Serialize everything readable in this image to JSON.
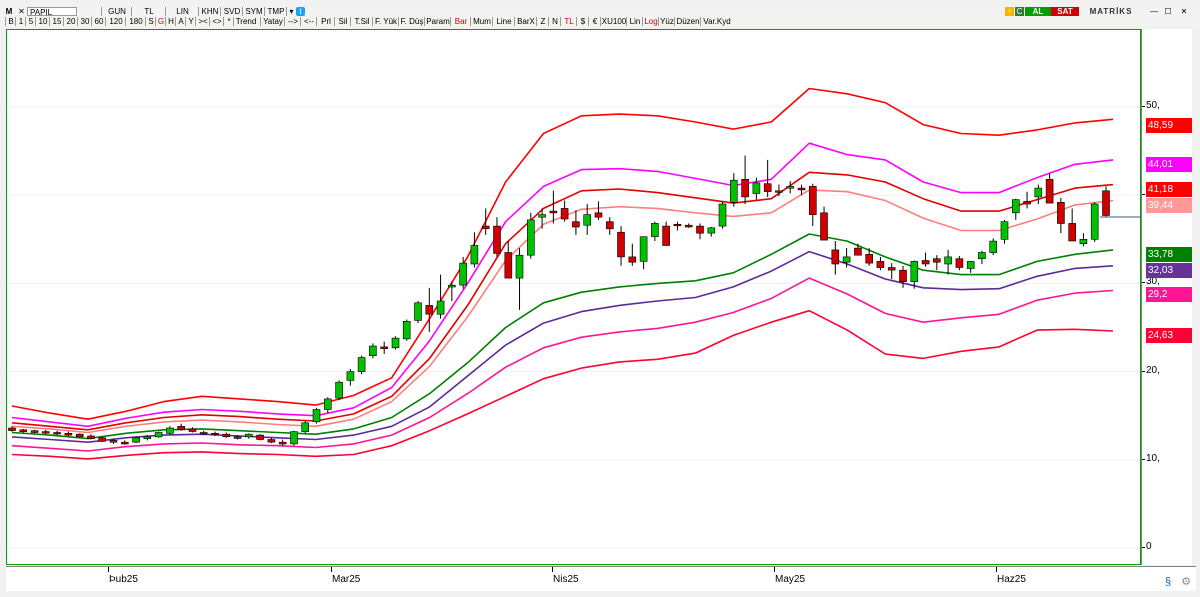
{
  "toolbar_top": {
    "window_icon": "M",
    "symbol": "PAPIL",
    "period": "GUN",
    "currency": "TL",
    "scale": "LIN",
    "items": [
      "KHN",
      "SVD",
      "SYM",
      "TMP"
    ],
    "market_status": {
      "buy": "AL",
      "sell": "SAT"
    },
    "brand": "MATRİKS"
  },
  "toolbar_bottom": {
    "items": [
      "B",
      "1",
      "5",
      "10",
      "15",
      "20",
      "30",
      "60",
      "120",
      "180",
      "S",
      "G",
      "H",
      "A",
      "Y",
      "><",
      "<>",
      "*",
      "Trend",
      "Yatay",
      "-->",
      "<--",
      "Prl",
      "Sil",
      "T.Sil",
      "F. Yük",
      "F. Düş",
      "Param",
      "Bar",
      "Mum",
      "Line",
      "BarX",
      "Z",
      "N",
      "TL",
      "$",
      "€",
      "XU100",
      "Lin",
      "Log",
      "Yüz",
      "Düzen",
      "Var.Kyd"
    ]
  },
  "price_axis": {
    "ticks": [
      "50,",
      "40,",
      "30,",
      "20,",
      "10,",
      "0"
    ],
    "labels": [
      {
        "text": "48,59",
        "color": "#ff0000",
        "text_color": "#ffffff",
        "value": 48.59
      },
      {
        "text": "44,01",
        "color": "#ff00ff",
        "text_color": "#ffffff",
        "value": 44.01
      },
      {
        "text": "41,18",
        "color": "#ff0000",
        "text_color": "#ffffff",
        "value": 41.18
      },
      {
        "text": "39,44",
        "color": "#ff9999",
        "text_color": "#ffffff",
        "value": 39.44
      },
      {
        "text": "33,78",
        "color": "#008000",
        "text_color": "#ffffff",
        "value": 33.78
      },
      {
        "text": "32,03",
        "color": "#663399",
        "text_color": "#ffffff",
        "value": 32.03
      },
      {
        "text": "29,2",
        "color": "#ff1493",
        "text_color": "#ffffff",
        "value": 29.2
      },
      {
        "text": "24,63",
        "color": "#ff0033",
        "text_color": "#ffffff",
        "value": 24.63
      }
    ]
  },
  "date_axis": {
    "ticks": [
      "Þub25",
      "Mar25",
      "Nis25",
      "May25",
      "Haz25"
    ]
  },
  "chart_data": {
    "type": "candlestick",
    "symbol": "PAPIL",
    "period": "GUN",
    "ylim": [
      0,
      61
    ],
    "colors": {
      "up": "#00c000",
      "down": "#d00000",
      "outer": "#ff0000",
      "mid1": "#ff00ff",
      "mid2": "#ff0000",
      "basis": "#ff8080",
      "lower1": "#008000",
      "lower2": "#5b2a9a",
      "lower3": "#ff1493",
      "lower4": "#ff0033"
    },
    "candles": [
      [
        13.6,
        13.8,
        13.2,
        13.3
      ],
      [
        13.4,
        13.5,
        13.1,
        13.2
      ],
      [
        13.3,
        13.4,
        13.0,
        13.1
      ],
      [
        13.2,
        13.4,
        12.9,
        13.1
      ],
      [
        13.1,
        13.3,
        12.8,
        13.0
      ],
      [
        13.0,
        13.2,
        12.6,
        12.8
      ],
      [
        12.9,
        13.0,
        12.5,
        12.6
      ],
      [
        12.7,
        12.9,
        12.3,
        12.4
      ],
      [
        12.5,
        12.6,
        12.0,
        12.1
      ],
      [
        12.2,
        12.4,
        11.8,
        12.0
      ],
      [
        12.0,
        12.2,
        11.7,
        11.8
      ],
      [
        12.0,
        12.6,
        11.9,
        12.5
      ],
      [
        12.4,
        12.8,
        12.2,
        12.6
      ],
      [
        12.6,
        13.2,
        12.5,
        13.1
      ],
      [
        13.0,
        13.8,
        12.9,
        13.6
      ],
      [
        13.8,
        14.1,
        13.3,
        13.4
      ],
      [
        13.5,
        13.7,
        13.1,
        13.2
      ],
      [
        13.1,
        13.3,
        12.8,
        13.0
      ],
      [
        13.0,
        13.2,
        12.7,
        12.9
      ],
      [
        12.9,
        13.1,
        12.5,
        12.6
      ],
      [
        12.6,
        12.8,
        12.3,
        12.5
      ],
      [
        12.6,
        13.0,
        12.4,
        12.9
      ],
      [
        12.8,
        12.9,
        12.2,
        12.3
      ],
      [
        12.3,
        12.5,
        11.9,
        12.0
      ],
      [
        12.0,
        12.3,
        11.6,
        11.8
      ],
      [
        11.8,
        13.3,
        11.6,
        13.2
      ],
      [
        13.2,
        14.4,
        13.0,
        14.2
      ],
      [
        14.3,
        15.9,
        14.1,
        15.7
      ],
      [
        15.7,
        17.1,
        15.3,
        16.9
      ],
      [
        17.0,
        19.0,
        16.8,
        18.8
      ],
      [
        19.0,
        20.3,
        18.4,
        20.0
      ],
      [
        20.0,
        21.8,
        19.7,
        21.6
      ],
      [
        21.8,
        23.2,
        21.5,
        22.9
      ],
      [
        22.8,
        23.4,
        22.0,
        22.6
      ],
      [
        22.7,
        24.0,
        22.5,
        23.8
      ],
      [
        23.7,
        25.9,
        23.5,
        25.7
      ],
      [
        25.8,
        28.0,
        25.5,
        27.8
      ],
      [
        27.5,
        29.5,
        24.5,
        26.5
      ],
      [
        26.5,
        31.0,
        26.0,
        28.0
      ],
      [
        29.6,
        30.2,
        28.0,
        29.8
      ],
      [
        29.8,
        33.0,
        29.4,
        32.3
      ],
      [
        32.2,
        35.8,
        31.8,
        34.3
      ],
      [
        36.5,
        38.5,
        35.5,
        36.2
      ],
      [
        36.5,
        37.5,
        33.0,
        33.4
      ],
      [
        33.5,
        34.8,
        32.0,
        30.6
      ],
      [
        30.6,
        34.0,
        27.0,
        33.2
      ],
      [
        33.2,
        38.0,
        32.8,
        37.2
      ],
      [
        37.5,
        38.5,
        36.2,
        37.8
      ],
      [
        38.2,
        40.5,
        36.8,
        38.0
      ],
      [
        38.5,
        39.4,
        37.0,
        37.3
      ],
      [
        37.0,
        38.3,
        35.5,
        36.4
      ],
      [
        36.6,
        39.0,
        35.5,
        37.8
      ],
      [
        38.0,
        39.3,
        37.2,
        37.5
      ],
      [
        37.0,
        37.5,
        35.5,
        36.2
      ],
      [
        35.8,
        36.5,
        32.0,
        33.0
      ],
      [
        33.0,
        34.5,
        32.0,
        32.4
      ],
      [
        32.5,
        35.0,
        31.6,
        35.3
      ],
      [
        35.3,
        37.0,
        34.8,
        36.8
      ],
      [
        36.5,
        37.0,
        34.5,
        34.3
      ],
      [
        36.7,
        37.0,
        36.0,
        36.6
      ],
      [
        36.6,
        36.8,
        36.3,
        36.4
      ],
      [
        36.5,
        36.8,
        35.0,
        35.7
      ],
      [
        35.7,
        36.4,
        35.3,
        36.3
      ],
      [
        36.5,
        39.3,
        36.2,
        39.0
      ],
      [
        39.2,
        42.5,
        38.7,
        41.7
      ],
      [
        41.8,
        44.5,
        39.0,
        39.8
      ],
      [
        40.2,
        42.0,
        39.5,
        41.4
      ],
      [
        41.3,
        44.0,
        39.8,
        40.4
      ],
      [
        40.5,
        41.2,
        39.9,
        40.4
      ],
      [
        40.8,
        41.6,
        40.2,
        41.0
      ],
      [
        40.8,
        41.2,
        40.0,
        40.6
      ],
      [
        41.0,
        41.3,
        36.5,
        37.8
      ],
      [
        38.0,
        38.7,
        35.0,
        34.9
      ],
      [
        33.8,
        34.8,
        31.0,
        32.2
      ],
      [
        32.4,
        34.0,
        31.8,
        33.0
      ],
      [
        34.0,
        34.5,
        33.3,
        33.2
      ],
      [
        33.3,
        34.0,
        32.0,
        32.3
      ],
      [
        32.5,
        33.0,
        31.5,
        31.8
      ],
      [
        31.8,
        32.3,
        30.5,
        31.5
      ],
      [
        31.5,
        32.0,
        29.5,
        30.2
      ],
      [
        30.2,
        32.6,
        29.4,
        32.5
      ],
      [
        32.6,
        33.5,
        31.9,
        32.2
      ],
      [
        32.8,
        33.2,
        31.5,
        32.4
      ],
      [
        32.2,
        33.8,
        31.0,
        33.0
      ],
      [
        32.8,
        33.1,
        31.5,
        31.8
      ],
      [
        31.7,
        32.5,
        31.2,
        32.5
      ],
      [
        32.8,
        33.7,
        32.2,
        33.5
      ],
      [
        33.5,
        35.1,
        33.2,
        34.8
      ],
      [
        35.0,
        37.2,
        34.5,
        37.0
      ],
      [
        38.0,
        39.6,
        37.2,
        39.5
      ],
      [
        39.3,
        40.4,
        38.5,
        39.0
      ],
      [
        39.8,
        41.2,
        39.0,
        40.8
      ],
      [
        41.8,
        42.5,
        40.5,
        39.1
      ],
      [
        39.2,
        39.7,
        35.7,
        36.8
      ],
      [
        36.8,
        38.5,
        34.8,
        34.8
      ],
      [
        34.5,
        35.7,
        34.2,
        35.0
      ],
      [
        35.0,
        39.2,
        34.7,
        39.0
      ],
      [
        40.5,
        41.0,
        37.6,
        37.7
      ]
    ],
    "bands": {
      "outer_upper": [
        16.1,
        15.3,
        14.6,
        15.5,
        16.6,
        17.2,
        16.9,
        16.6,
        16.2,
        17.3,
        19.3,
        26.0,
        33.0,
        41.5,
        47.0,
        49.0,
        49.2,
        49.0,
        48.3,
        47.5,
        48.3,
        52.1,
        51.5,
        50.5,
        48.0,
        47.0,
        46.8,
        47.4,
        48.2,
        48.6
      ],
      "mid1_upper": [
        14.8,
        14.3,
        13.8,
        14.7,
        15.4,
        15.7,
        15.5,
        15.2,
        15.0,
        15.9,
        18.2,
        23.5,
        30.0,
        37.0,
        41.0,
        42.9,
        43.0,
        42.7,
        41.9,
        41.1,
        41.8,
        45.9,
        44.6,
        44.0,
        41.5,
        40.3,
        40.3,
        42.0,
        43.5,
        44.0
      ],
      "mid2_upper": [
        14.2,
        13.8,
        13.4,
        14.2,
        14.8,
        15.1,
        14.9,
        14.6,
        14.4,
        15.2,
        17.2,
        21.5,
        27.5,
        34.5,
        38.5,
        40.5,
        40.7,
        40.3,
        39.7,
        39.1,
        39.6,
        42.6,
        42.3,
        41.5,
        39.6,
        38.2,
        38.2,
        39.5,
        40.8,
        41.2
      ],
      "basis": [
        13.8,
        13.5,
        13.1,
        13.8,
        14.3,
        14.5,
        14.3,
        14.0,
        13.8,
        14.6,
        16.6,
        20.6,
        26.2,
        32.6,
        36.7,
        38.4,
        38.7,
        38.5,
        38.0,
        37.6,
        38.0,
        40.6,
        40.4,
        39.4,
        37.4,
        36.0,
        36.0,
        37.3,
        38.9,
        39.4
      ],
      "lower1": [
        13.1,
        12.8,
        12.4,
        13.0,
        13.4,
        13.5,
        13.3,
        13.1,
        12.9,
        13.5,
        14.8,
        17.5,
        21.0,
        25.0,
        27.8,
        29.0,
        29.6,
        30.0,
        30.3,
        31.2,
        33.3,
        35.6,
        34.8,
        33.0,
        31.5,
        31.0,
        31.0,
        32.5,
        33.3,
        33.8
      ],
      "lower2": [
        12.6,
        12.3,
        12.0,
        12.5,
        12.8,
        12.9,
        12.7,
        12.5,
        12.3,
        12.8,
        13.8,
        16.0,
        19.5,
        23.0,
        25.5,
        26.8,
        27.5,
        28.0,
        28.4,
        29.6,
        31.4,
        33.6,
        32.2,
        30.5,
        29.5,
        29.3,
        29.4,
        30.8,
        31.7,
        32.0
      ],
      "lower3": [
        11.6,
        11.3,
        11.0,
        11.5,
        11.8,
        11.9,
        11.7,
        11.6,
        11.4,
        11.8,
        12.8,
        14.8,
        17.5,
        20.5,
        22.7,
        23.9,
        24.5,
        24.9,
        25.6,
        26.7,
        28.3,
        30.6,
        28.8,
        26.6,
        25.6,
        26.1,
        26.5,
        28.1,
        28.9,
        29.2
      ],
      "lower4": [
        10.6,
        10.4,
        10.1,
        10.5,
        10.8,
        10.9,
        10.7,
        10.6,
        10.4,
        10.6,
        11.6,
        13.3,
        15.2,
        17.2,
        19.2,
        20.4,
        21.1,
        21.4,
        22.1,
        24.1,
        25.6,
        26.9,
        24.7,
        22.0,
        21.5,
        22.3,
        22.8,
        24.7,
        24.8,
        24.6
      ]
    }
  }
}
